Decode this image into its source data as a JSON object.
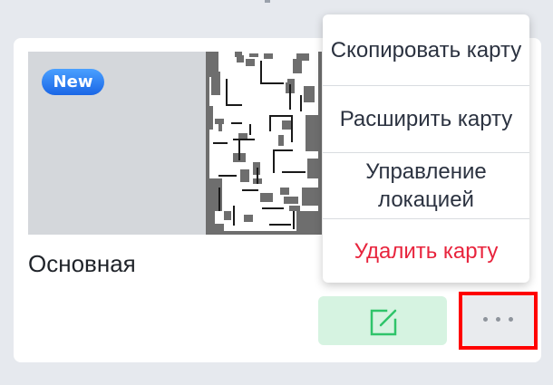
{
  "map_card": {
    "badge_label": "New",
    "name": "Основная",
    "edit_icon": "edit-icon",
    "more_icon": "more-horizontal-icon"
  },
  "menu": {
    "items": [
      {
        "label": "Скопировать карту",
        "danger": false
      },
      {
        "label": "Расширить карту",
        "danger": false
      },
      {
        "label": "Управление локацией",
        "danger": false
      },
      {
        "label": "Удалить карту",
        "danger": true
      }
    ]
  },
  "colors": {
    "badge": "#1a66e6",
    "edit_button_bg": "#d6f3e1",
    "edit_icon": "#2fc46a",
    "danger": "#e8243d",
    "highlight": "#ff0000"
  }
}
